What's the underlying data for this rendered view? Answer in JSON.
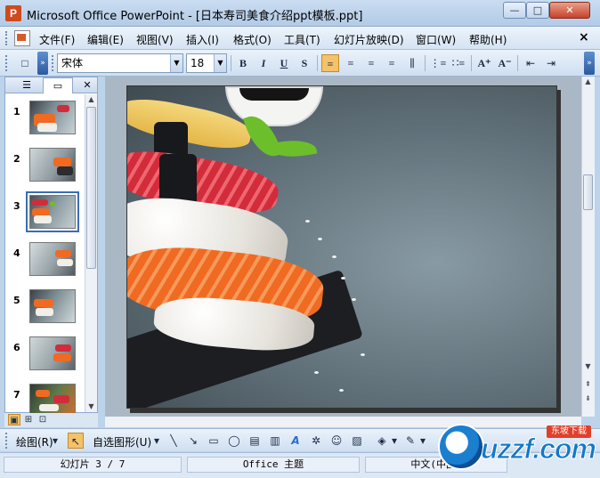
{
  "window": {
    "title": "Microsoft Office PowerPoint - [日本寿司美食介绍ppt模板.ppt]",
    "app_icon_glyph": "P",
    "minimize_label": "—",
    "maximize_label": "□",
    "close_label": "✕"
  },
  "menubar": {
    "items": [
      "文件(F)",
      "编辑(E)",
      "视图(V)",
      "插入(I)",
      "格式(O)",
      "工具(T)",
      "幻灯片放映(D)",
      "窗口(W)",
      "帮助(H)"
    ],
    "close_glyph": "×"
  },
  "format_toolbar": {
    "new_glyph": "□",
    "font_name": "宋体",
    "font_size": "18",
    "bold": "B",
    "italic": "I",
    "underline": "U",
    "shadow": "S",
    "align_left": "≡",
    "align_center": "≡",
    "align_right": "≡",
    "distribute": "≡",
    "vertical": "⫼",
    "numbering": "⋮≡",
    "bullets": "∷≡",
    "grow_font": "A⁺",
    "shrink_font": "A⁻",
    "dec_indent": "⇤",
    "inc_indent": "⇥",
    "chevron": "»",
    "combo_arrow": "▼"
  },
  "left_pane": {
    "tab_outline": "☰",
    "tab_slides": "▭",
    "close_glyph": "✕",
    "slides": [
      {
        "number": "1"
      },
      {
        "number": "2"
      },
      {
        "number": "3"
      },
      {
        "number": "4"
      },
      {
        "number": "5"
      },
      {
        "number": "6"
      },
      {
        "number": "7"
      }
    ],
    "selected_slide": "3",
    "scroll_up": "▲",
    "scroll_down": "▼"
  },
  "view_buttons": {
    "normal": "▣",
    "sorter": "⊞",
    "show": "⊡"
  },
  "slide_scroll": {
    "up": "▲",
    "down": "▼",
    "prev": "⇞",
    "next": "⇟"
  },
  "drawing_toolbar": {
    "draw_menu": "绘图(R)",
    "autoshapes_menu": "自选图形(U)",
    "select_glyph": "↖",
    "line_glyph": "╲",
    "arrow_glyph": "↘",
    "rect_glyph": "▭",
    "oval_glyph": "◯",
    "textbox_glyph": "▤",
    "vtext_glyph": "▥",
    "wordart_glyph": "A",
    "diagram_glyph": "✲",
    "clipart_glyph": "☺",
    "picture_glyph": "▨",
    "fill_glyph": "◈",
    "linecolor_glyph": "✎",
    "dropdown": "▾"
  },
  "statusbar": {
    "slide_info": "幻灯片 3 / 7",
    "theme": "Office 主题",
    "language": "中文(中国)"
  },
  "watermark": {
    "brand": "uzzf.com",
    "tag": "东坡下载"
  },
  "colors": {
    "accent": "#3a6cb5",
    "titlebar": "#c9dcf1",
    "brand": "#1478c8"
  }
}
